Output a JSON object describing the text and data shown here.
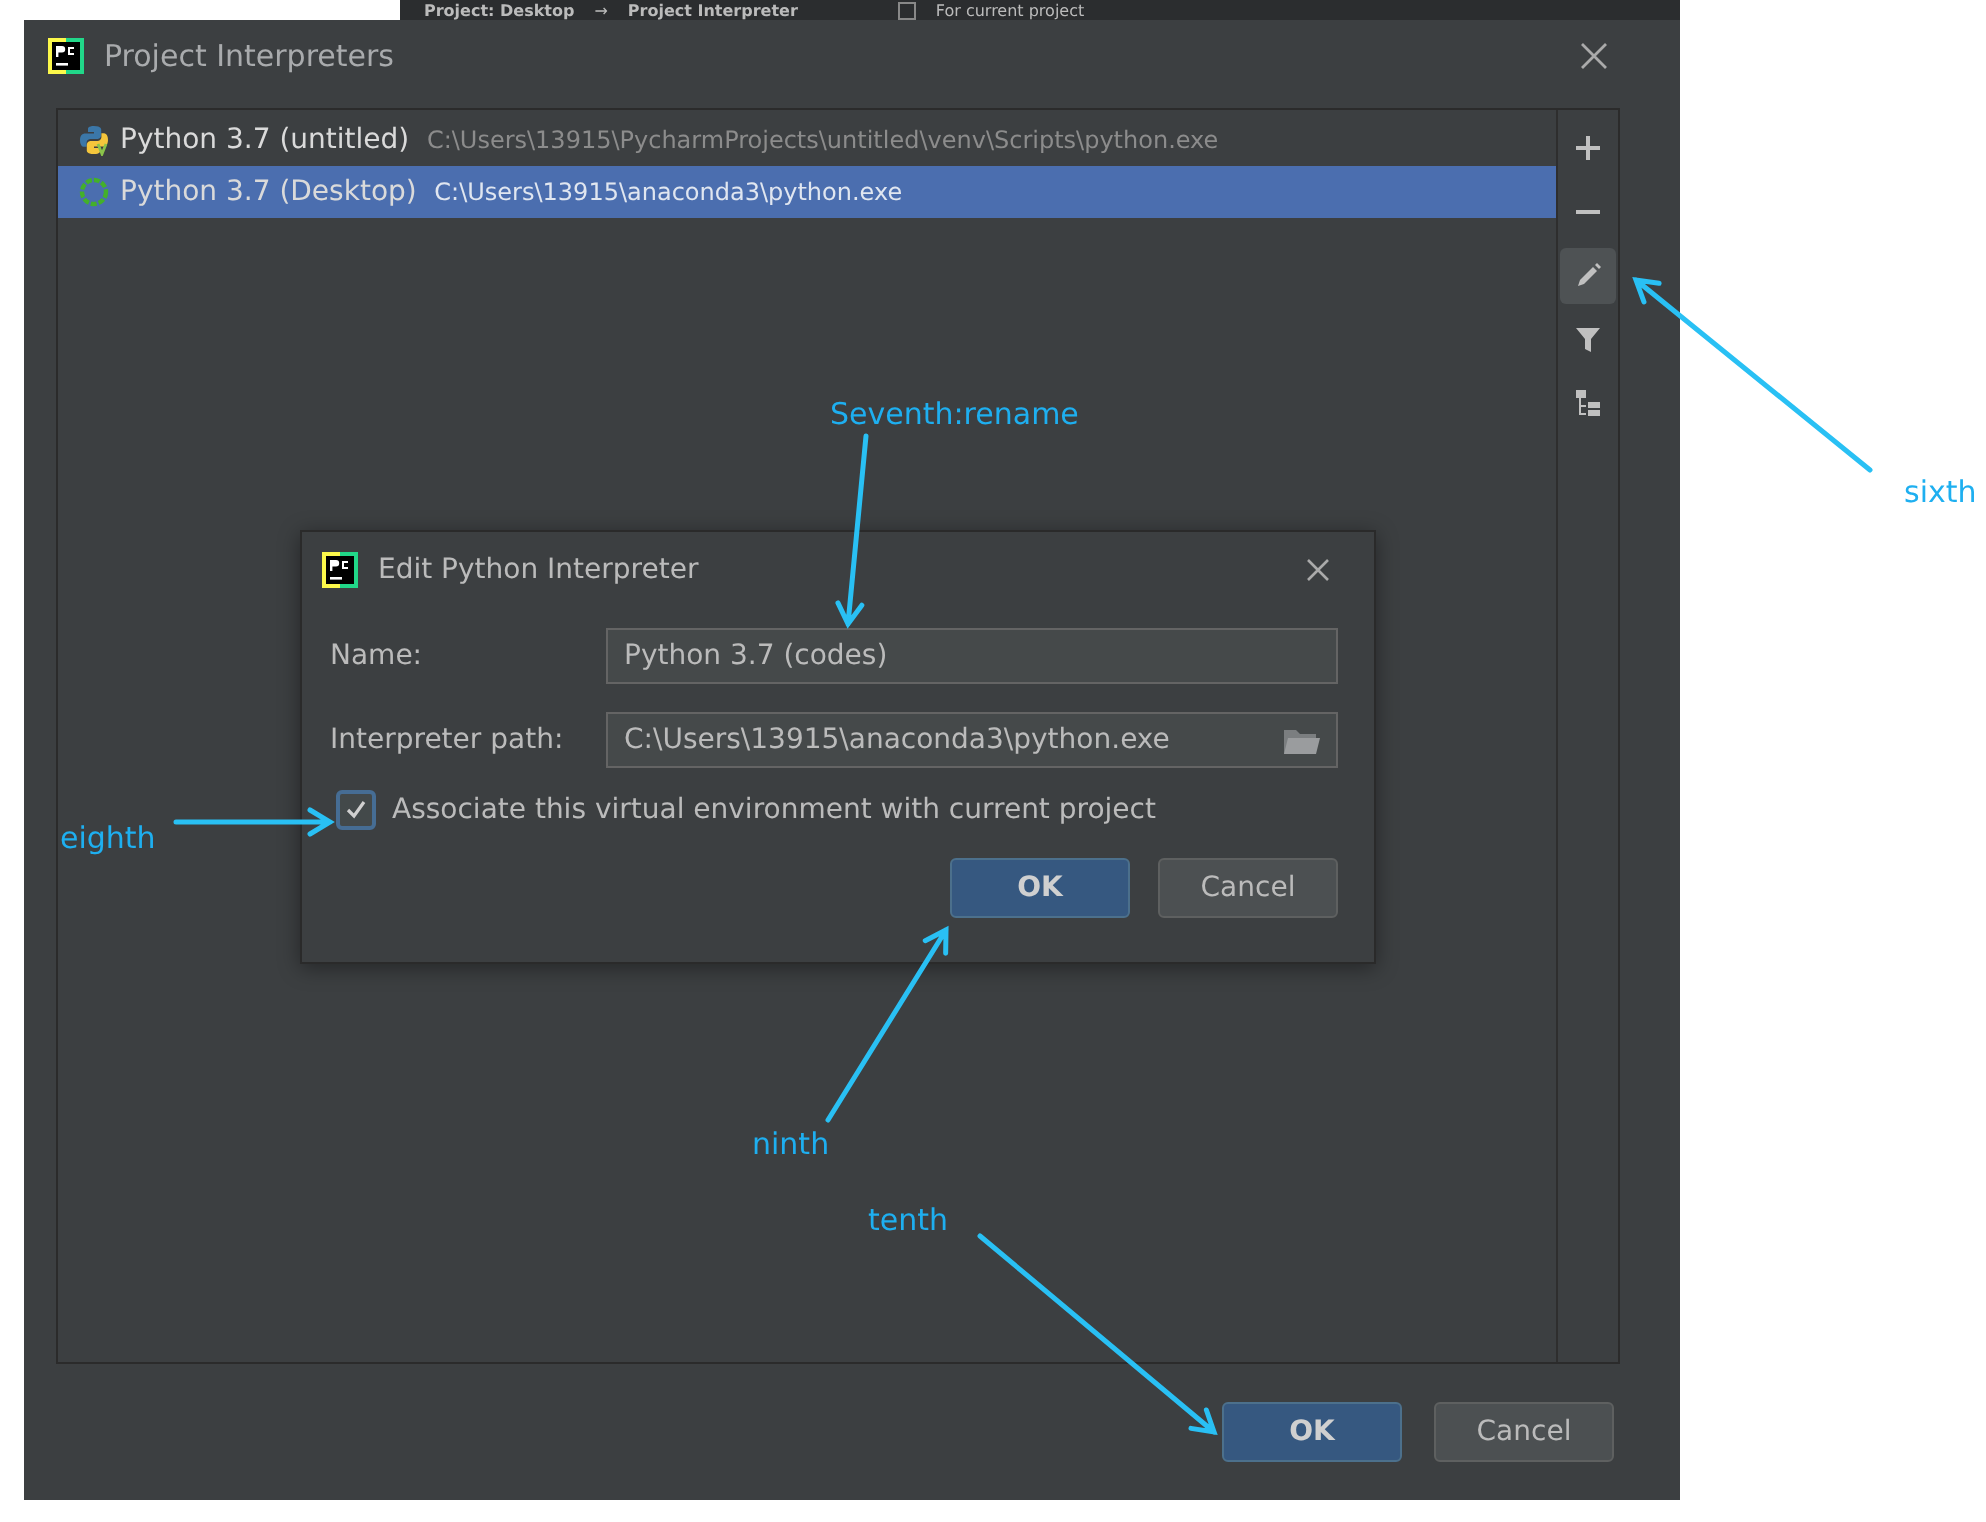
{
  "background_header": {
    "breadcrumb": [
      "Project: Desktop",
      "Project Interpreter"
    ],
    "separator": "→",
    "option": "For current project"
  },
  "window": {
    "title": "Project Interpreters"
  },
  "interpreters": [
    {
      "name": "Python 3.7 (untitled)",
      "path": "C:\\Users\\13915\\PycharmProjects\\untitled\\venv\\Scripts\\python.exe",
      "kind": "venv",
      "selected": false
    },
    {
      "name": "Python 3.7 (Desktop)",
      "path": "C:\\Users\\13915\\anaconda3\\python.exe",
      "kind": "conda",
      "selected": true
    }
  ],
  "toolbar": [
    {
      "kind": "add",
      "selected": false
    },
    {
      "kind": "remove",
      "selected": false
    },
    {
      "kind": "edit",
      "selected": true
    },
    {
      "kind": "filter",
      "selected": false
    },
    {
      "kind": "tree",
      "selected": false
    }
  ],
  "edit_dialog": {
    "title": "Edit Python Interpreter",
    "fields": [
      {
        "label": "Name:",
        "value": "Python 3.7 (codes)",
        "kind": "text"
      },
      {
        "label": "Interpreter path:",
        "value": "C:\\Users\\13915\\anaconda3\\python.exe",
        "kind": "browse"
      }
    ],
    "checkbox": {
      "label": "Associate this virtual environment with current project",
      "checked": true
    },
    "buttons": [
      {
        "label": "OK",
        "kind": "default"
      },
      {
        "label": "Cancel",
        "kind": "normal"
      }
    ]
  },
  "buttons": [
    {
      "label": "OK",
      "kind": "default"
    },
    {
      "label": "Cancel",
      "kind": "normal"
    }
  ],
  "annotations": [
    "Seventh:rename",
    "sixth",
    "eighth",
    "ninth",
    "tenth"
  ]
}
